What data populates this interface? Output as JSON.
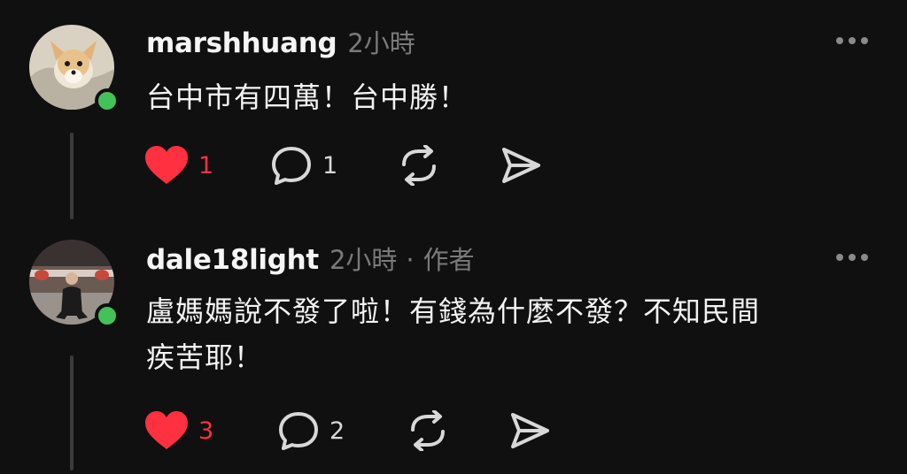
{
  "posts": [
    {
      "username": "marshhuang",
      "time": "2小時",
      "author_badge": "",
      "text": "台中市有四萬！台中勝！",
      "likes": "1",
      "comments": "1",
      "liked": true,
      "online": true
    },
    {
      "username": "dale18light",
      "time": "2小時",
      "author_badge": "作者",
      "separator": "·",
      "text_line1": "盧媽媽說不發了啦！有錢為什麼不發？不知民間",
      "text_line2": "疾苦耶！",
      "likes": "3",
      "comments": "2",
      "liked": true,
      "online": true
    }
  ],
  "icons": {
    "like": "heart-icon",
    "comment": "comment-bubble-icon",
    "repost": "repost-icon",
    "share": "send-icon",
    "more": "more-options-icon"
  },
  "colors": {
    "background": "#101010",
    "like_active": "#ff3040",
    "online": "#44c25a",
    "muted_text": "#7a7a7a"
  }
}
